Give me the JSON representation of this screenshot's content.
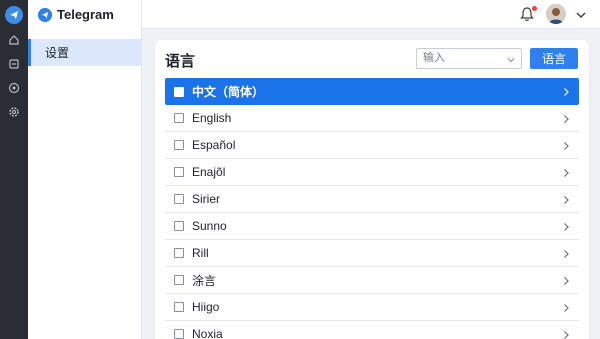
{
  "app": {
    "name": "Telegram"
  },
  "sidebar": {
    "items": [
      {
        "label": "设置"
      }
    ]
  },
  "main": {
    "title": "语言",
    "input": {
      "value": "输入"
    },
    "button_label": "语言",
    "languages": [
      {
        "label": "中文（简体）",
        "selected": true
      },
      {
        "label": "English",
        "selected": false
      },
      {
        "label": "Español",
        "selected": false
      },
      {
        "label": "Enajõl",
        "selected": false
      },
      {
        "label": "Sirier",
        "selected": false
      },
      {
        "label": "Sunno",
        "selected": false
      },
      {
        "label": "Rill",
        "selected": false
      },
      {
        "label": "涂言",
        "selected": false
      },
      {
        "label": "Hiigo",
        "selected": false
      },
      {
        "label": "Noxia",
        "selected": false
      }
    ]
  },
  "colors": {
    "accent": "#2f80ed",
    "selected_row": "#1a73e8",
    "rail": "#2a2d33",
    "notification": "#f04438"
  },
  "icons": [
    "telegram-logo-icon",
    "home-icon",
    "inbox-icon",
    "eye-icon",
    "settings-icon",
    "bell-icon",
    "chevron-down-icon",
    "chevron-right-icon"
  ]
}
